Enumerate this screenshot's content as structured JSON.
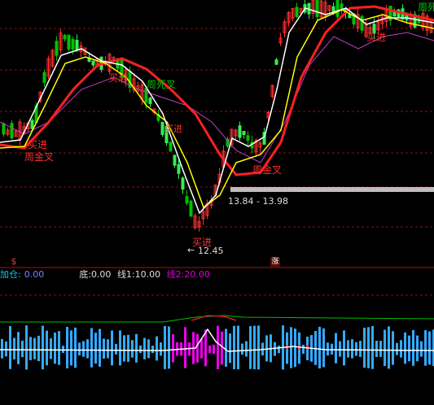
{
  "colors": {
    "background": "#000000",
    "up": "#ff3030",
    "down": "#00c000",
    "down_light": "#33ee55",
    "ma5": "#ffffff",
    "ma10": "#ffff00",
    "ma20": "#ff2020",
    "ma60": "#c040c0",
    "grid": "#8b1010",
    "label_cyan": "#00ccff",
    "label_magenta": "#dd00dd",
    "hist_blue": "#33aaff",
    "hist_magenta": "#ee00ee",
    "hist_red": "#ff4040",
    "hist_green": "#00bb00"
  },
  "annotations": {
    "week_golden_cross_1": "周金叉",
    "week_golden_cross_2": "周金叉",
    "buy_1": "买进",
    "buy_2": "买进",
    "buy_3": "买进",
    "buy_4": "买进",
    "week_dead_cross": "周死叉",
    "week_dead_cross_top": "周死",
    "buy_top": "买进",
    "range_label": "13.84 - 13.98",
    "low_label": "12.45",
    "low_arrow": "←"
  },
  "markers": {
    "left_marker": "$",
    "right_marker": "涨"
  },
  "indicator": {
    "add_label": "加仓:",
    "add_value": "0.00",
    "bottom_label": "底:",
    "bottom_value": "0.00",
    "line1_label": "线1:",
    "line1_value": "10.00",
    "line2_label": "线2:",
    "line2_value": "20.00"
  }
}
